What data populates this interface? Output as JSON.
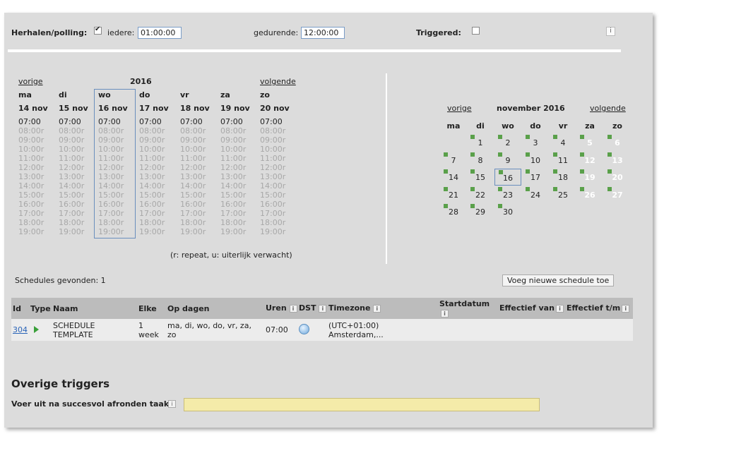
{
  "polling": {
    "label": "Herhalen/polling:",
    "checked": true,
    "every_label": "iedere:",
    "every_value": "01:00:00",
    "during_label": "gedurende:",
    "during_value": "12:00:00",
    "triggered_label": "Triggered:",
    "triggered_checked": false,
    "info": "i"
  },
  "week": {
    "prev": "vorige",
    "next": "volgende",
    "year": "2016",
    "days": [
      {
        "abbr": "ma",
        "date": "14 nov",
        "first": "07:00",
        "selected": false
      },
      {
        "abbr": "di",
        "date": "15 nov",
        "first": "07:00",
        "selected": false
      },
      {
        "abbr": "wo",
        "date": "16 nov",
        "first": "07:00",
        "selected": true
      },
      {
        "abbr": "do",
        "date": "17 nov",
        "first": "07:00",
        "selected": false
      },
      {
        "abbr": "vr",
        "date": "18 nov",
        "first": "07:00",
        "selected": false
      },
      {
        "abbr": "za",
        "date": "19 nov",
        "first": "07:00",
        "selected": false
      },
      {
        "abbr": "zo",
        "date": "20 nov",
        "first": "07:00",
        "selected": false
      }
    ],
    "repeat_slots": [
      "08:00r",
      "09:00r",
      "10:00r",
      "11:00r",
      "12:00r",
      "13:00r",
      "14:00r",
      "15:00r",
      "16:00r",
      "17:00r",
      "18:00r",
      "19:00r"
    ],
    "legend": "(r: repeat, u: uiterlijk verwacht)"
  },
  "month": {
    "prev": "vorige",
    "next": "volgende",
    "title": "november 2016",
    "weekdays": [
      "ma",
      "di",
      "wo",
      "do",
      "vr",
      "za",
      "zo"
    ],
    "weeks": [
      [
        "",
        "1",
        "2",
        "3",
        "4",
        "5",
        "6"
      ],
      [
        "7",
        "8",
        "9",
        "10",
        "11",
        "12",
        "13"
      ],
      [
        "14",
        "15",
        "16",
        "17",
        "18",
        "19",
        "20"
      ],
      [
        "21",
        "22",
        "23",
        "24",
        "25",
        "26",
        "27"
      ],
      [
        "28",
        "29",
        "30",
        "",
        "",
        "",
        ""
      ]
    ],
    "selected": "16",
    "dot_color": "#5aa04a"
  },
  "schedules": {
    "found_label": "Schedules gevonden: 1",
    "add_button": "Voeg nieuwe schedule toe",
    "columns": {
      "id": "Id",
      "type": "Type",
      "name": "Naam",
      "every": "Elke",
      "days": "Op dagen",
      "hours": "Uren",
      "dst": "DST",
      "timezone": "Timezone",
      "start": "Startdatum",
      "eff_from": "Effectief van",
      "eff_to": "Effectief t/m"
    },
    "rows": [
      {
        "id": "304",
        "name_line1": "SCHEDULE",
        "name_line2": "TEMPLATE",
        "every_line1": "1",
        "every_line2": "week",
        "days_line1": "ma, di, wo, do, vr, za,",
        "days_line2": "zo",
        "hours": "07:00",
        "tz_line1": "(UTC+01:00)",
        "tz_line2": "Amsterdam,..."
      }
    ]
  },
  "other_triggers": {
    "title": "Overige triggers",
    "run_after_label": "Voer uit na succesvol afronden taak:",
    "run_after_value": ""
  }
}
